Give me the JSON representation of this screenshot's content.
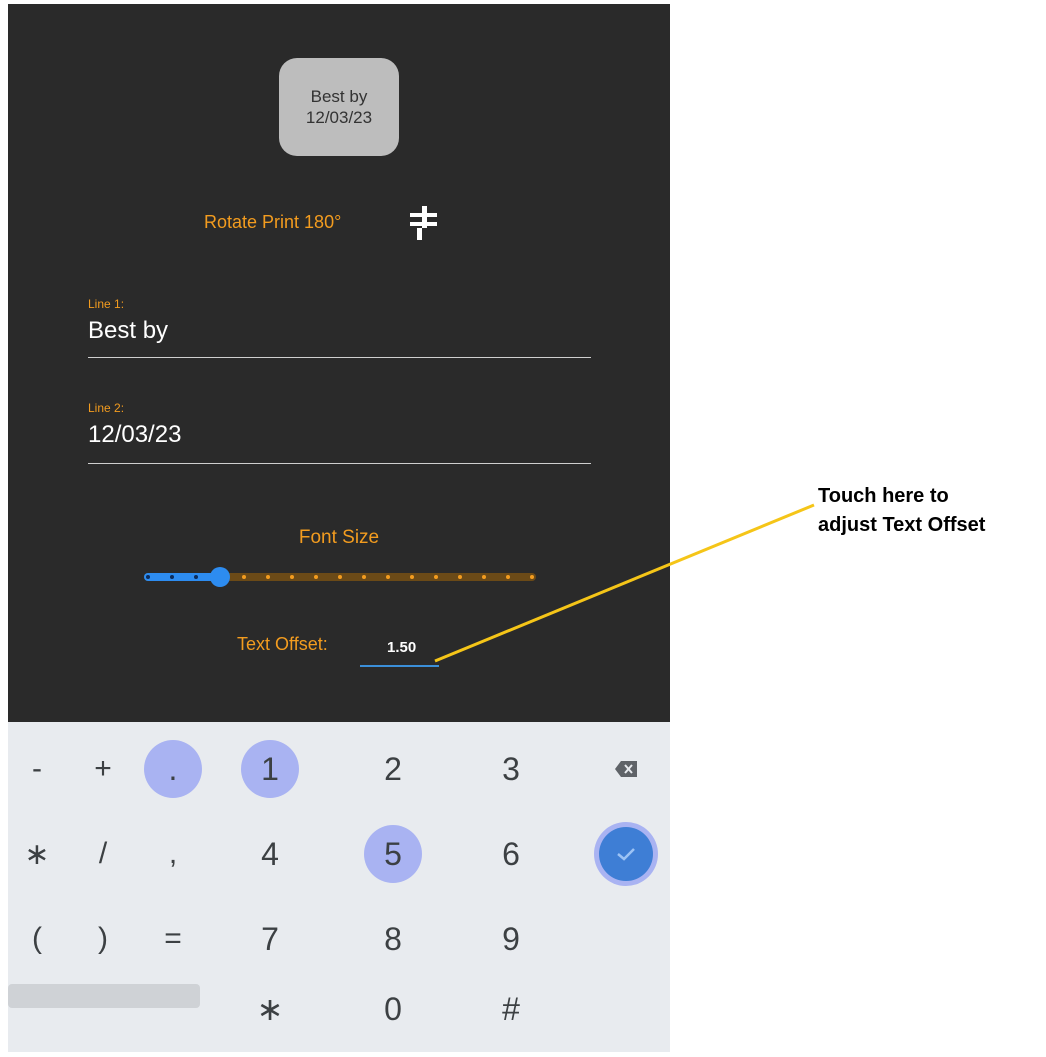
{
  "preview": {
    "line1": "Best by",
    "line2": "12/03/23"
  },
  "rotate": {
    "label": "Rotate Print 180°",
    "icon": "rotate-print-icon"
  },
  "fields": {
    "line1": {
      "label": "Line 1:",
      "value": "Best by"
    },
    "line2": {
      "label": "Line 2:",
      "value": "12/03/23"
    }
  },
  "font_size": {
    "label": "Font Size",
    "steps": 17,
    "selected_step": 3
  },
  "text_offset": {
    "label": "Text Offset:",
    "value": "1.50"
  },
  "keyboard": {
    "rows": [
      [
        "-",
        "+",
        ".",
        "1",
        "2",
        "3",
        "⌫"
      ],
      [
        "∗",
        "/",
        ",",
        "4",
        "5",
        "6",
        "✓"
      ],
      [
        "(",
        ")",
        "=",
        "7",
        "8",
        "9",
        ""
      ],
      [
        "",
        "",
        "",
        "∗",
        "0",
        "#",
        ""
      ]
    ],
    "highlighted": [
      ".",
      "1",
      "5"
    ]
  },
  "annotation": {
    "line1": "Touch here to",
    "line2": "adjust Text Offset"
  },
  "colors": {
    "accent": "#f39c1f",
    "slider": "#2d8cf0",
    "annotation_line": "#f5c518"
  }
}
